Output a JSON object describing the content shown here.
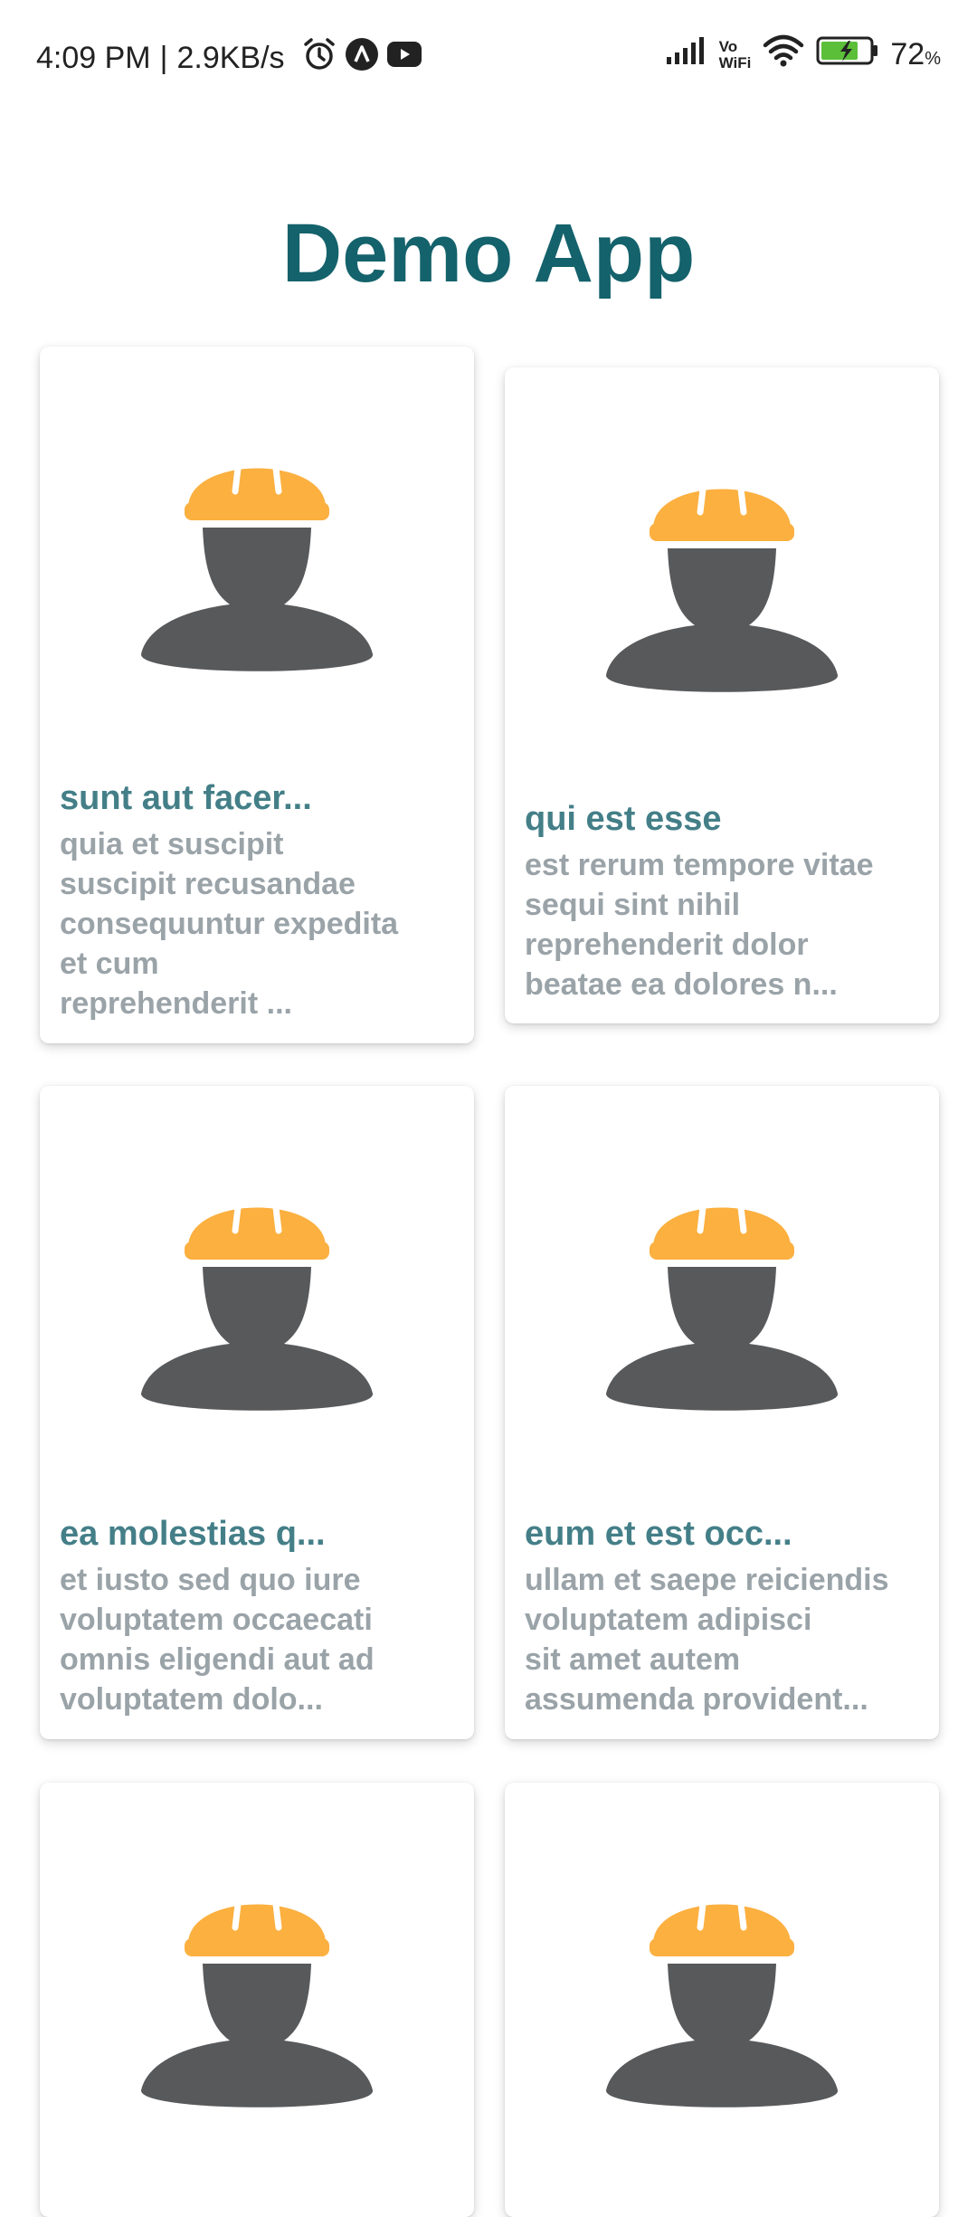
{
  "status_bar": {
    "time": "4:09 PM",
    "speed": "2.9KB/s",
    "vowifi_top": "Vo",
    "vowifi_bottom": "WiFi",
    "battery_value": "72",
    "battery_unit": "%",
    "left_icons": [
      "alarm-icon",
      "app-notification-icon",
      "youtube-icon"
    ],
    "right_icons": [
      "signal-icon",
      "wifi-icon",
      "battery-charging-icon"
    ]
  },
  "app": {
    "title": "Demo App"
  },
  "colors": {
    "title": "#14626b",
    "card_title": "#447f88",
    "card_body": "#9aa3a8",
    "helmet": "#fbb040",
    "silhouette": "#58595b"
  },
  "cards": [
    {
      "title": "sunt aut facer...",
      "body": "quia et suscipit\nsuscipit recusandae\nconsequuntur expedita\net cum\nreprehenderit ...",
      "icon": "construction-worker-icon"
    },
    {
      "title": "qui est esse",
      "body": "est rerum tempore vitae\nsequi sint nihil\nreprehenderit dolor\nbeatae ea dolores n...",
      "icon": "construction-worker-icon"
    },
    {
      "title": "ea molestias q...",
      "body": "et iusto sed quo iure\nvoluptatem occaecati\nomnis eligendi aut ad\nvoluptatem dolo...",
      "icon": "construction-worker-icon"
    },
    {
      "title": "eum et est occ...",
      "body": "ullam et saepe reiciendis\nvoluptatem adipisci\nsit amet autem\nassumenda provident...",
      "icon": "construction-worker-icon"
    },
    {
      "title": "",
      "body": "",
      "icon": "construction-worker-icon"
    },
    {
      "title": "",
      "body": "",
      "icon": "construction-worker-icon"
    }
  ]
}
